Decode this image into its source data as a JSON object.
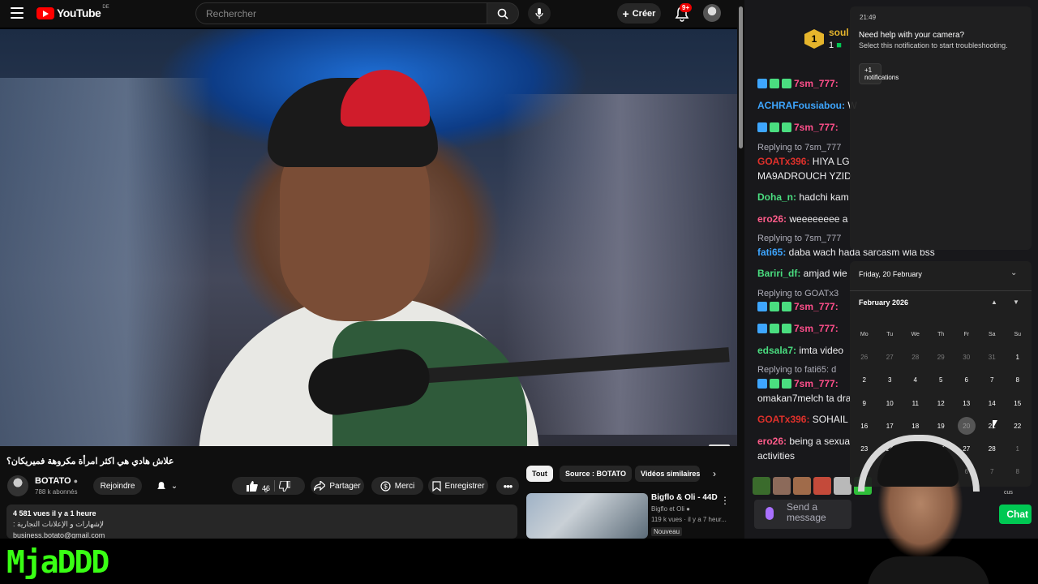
{
  "youtube": {
    "logo_text": "YouTube",
    "country_code": "DE",
    "search_placeholder": "Rechercher",
    "create_label": "Créer",
    "notif_badge": "9+",
    "video": {
      "title": "علاش هادي هي اكثر امرأة مكروهة فميريكان؟",
      "channel_name": "BOTATO",
      "subscribers": "788 k abonnés",
      "join_label": "Rejoindre",
      "likes": "46",
      "dislikes": "6",
      "share_label": "Partager",
      "thanks_label": "Merci",
      "save_label": "Enregistrer",
      "views_time": "4 581 vues  il y a 1 heure",
      "desc_line2": "لإشهارات و الإعلانات التجارية :",
      "desc_line3": "business.botato@gmail.com"
    },
    "chips": [
      "Tout",
      "Source : BOTATO",
      "Vidéos similaires"
    ],
    "recommended": {
      "title": "Bigflo & Oli - 44D",
      "channel": "Bigflo et Oli",
      "meta": "119 k vues · il y a 7 heur...",
      "badge": "Nouveau"
    }
  },
  "chat": {
    "header_name": "soul",
    "header_rank": "1",
    "header_count": "1",
    "messages": [
      {
        "user": "7sm_777:",
        "text": "",
        "color": "#ff4f8b",
        "reply": ""
      },
      {
        "user": "ACHRAFousiabou:",
        "text": " W",
        "color": "#3ea6ff",
        "reply": ""
      },
      {
        "user": "7sm_777:",
        "text": "",
        "color": "#ff4f8b",
        "reply": ""
      },
      {
        "user": "GOATx396:",
        "text": " HIYA LG",
        "color": "#e0312b",
        "reply": "Replying to 7sm_777"
      },
      {
        "user": "",
        "text": "MA9ADROUCH YZID",
        "color": "#efeff1",
        "reply": ""
      },
      {
        "user": "Doha_n:",
        "text": " hadchi kam",
        "color": "#4ade80",
        "reply": ""
      },
      {
        "user": "ero26:",
        "text": " weeeeeeee a",
        "color": "#ff5c8a",
        "reply": ""
      },
      {
        "user": "fati65:",
        "text": " daba wach hada sarcasm wla bss",
        "color": "#3ea6ff",
        "reply": "Replying to 7sm_777"
      },
      {
        "user": "Bariri_df:",
        "text": " amjad wie",
        "color": "#4ade80",
        "reply": ""
      },
      {
        "user": "7sm_777:",
        "text": "",
        "color": "#ff4f8b",
        "reply": "Replying to GOATx3"
      },
      {
        "user": "7sm_777:",
        "text": "",
        "color": "#ff4f8b",
        "reply": ""
      },
      {
        "user": "edsala7:",
        "text": " imta video",
        "color": "#4ade80",
        "reply": ""
      },
      {
        "user": "7sm_777:",
        "text": "",
        "color": "#ff4f8b",
        "reply": "Replying to fati65: d"
      },
      {
        "user": "",
        "text": "omakan7melch ta dra",
        "color": "#efeff1",
        "reply": ""
      },
      {
        "user": "GOATx396:",
        "text": " SOHAIL",
        "color": "#e0312b",
        "reply": ""
      },
      {
        "user": "ero26:",
        "text": " being a sexua",
        "color": "#ff5c8a",
        "reply": ""
      },
      {
        "user": "",
        "text": "activities",
        "color": "#efeff1",
        "reply": ""
      }
    ],
    "input_placeholder_line1": "Send a",
    "input_placeholder_line2": "message",
    "send_label": "Chat",
    "focus_label": "cus"
  },
  "notification": {
    "time": "21:49",
    "title": "Need help with your camera?",
    "body": "Select this notification to start troubleshooting.",
    "more": "+1 notifications"
  },
  "calendar": {
    "date_header": "Friday, 20 February",
    "month": "February 2026",
    "weekdays": [
      "Mo",
      "Tu",
      "We",
      "Th",
      "Fr",
      "Sa",
      "Su"
    ],
    "days": [
      [
        "26",
        "27",
        "28",
        "29",
        "30",
        "31",
        "1"
      ],
      [
        "2",
        "3",
        "4",
        "5",
        "6",
        "7",
        "8"
      ],
      [
        "9",
        "10",
        "11",
        "12",
        "13",
        "14",
        "15"
      ],
      [
        "16",
        "17",
        "18",
        "19",
        "20",
        "21",
        "22"
      ],
      [
        "23",
        "24",
        "25",
        "26",
        "27",
        "28",
        "1"
      ],
      [
        "2",
        "3",
        "4",
        "5",
        "6",
        "7",
        "8"
      ]
    ]
  },
  "overlay": {
    "brand": "MjaDDD",
    "brand_color": "#39ff14"
  }
}
